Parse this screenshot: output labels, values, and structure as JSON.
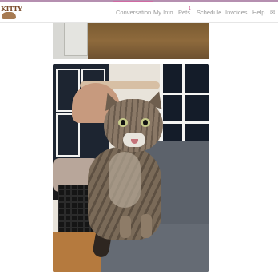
{
  "brand": {
    "logo_text": "KITTY"
  },
  "nav": {
    "items": [
      {
        "label": "Conversation",
        "active": true
      },
      {
        "label": "My Info",
        "active": false
      },
      {
        "label": "Pets",
        "active": false
      },
      {
        "label": "Schedule",
        "active": false
      },
      {
        "label": "Invoices",
        "active": false
      },
      {
        "label": "Help",
        "active": false
      }
    ],
    "pets_badge": "1"
  },
  "colors": {
    "accent_bar": "#b58fb0",
    "active_tab": "#d06aa3",
    "divider": "#9ed6c7"
  },
  "icons": {
    "messages": "envelope-icon"
  },
  "content": {
    "photos": [
      {
        "name": "photo-floor-door"
      },
      {
        "name": "photo-cat-on-couch"
      }
    ]
  }
}
